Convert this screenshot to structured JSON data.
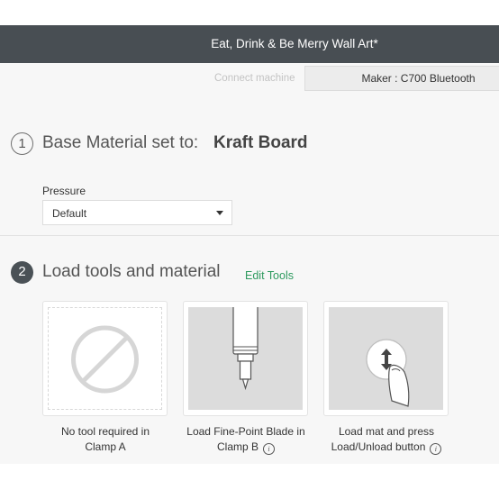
{
  "header": {
    "title": "Eat, Drink & Be Merry Wall Art*"
  },
  "connect": {
    "link_label": "Connect machine",
    "machine_label": "Maker : C700 Bluetooth"
  },
  "step1": {
    "number": "1",
    "label": "Base Material set to:",
    "material": "Kraft Board",
    "pressure_label": "Pressure",
    "pressure_value": "Default"
  },
  "step2": {
    "number": "2",
    "label": "Load tools and material",
    "edit_tools": "Edit Tools",
    "cards": [
      {
        "icon": "no-tool-icon",
        "line1": "No tool required in",
        "line2": "Clamp A"
      },
      {
        "icon": "fine-point-blade-icon",
        "line1": "Load Fine-Point Blade in",
        "line2": "Clamp B"
      },
      {
        "icon": "load-unload-button-icon",
        "line1": "Load mat and press",
        "line2": "Load/Unload button"
      }
    ]
  },
  "info_icon": "i",
  "colors": {
    "header_bg": "#484e53",
    "accent_green": "#2e9a5f",
    "panel_bg": "#f7f7f7"
  }
}
